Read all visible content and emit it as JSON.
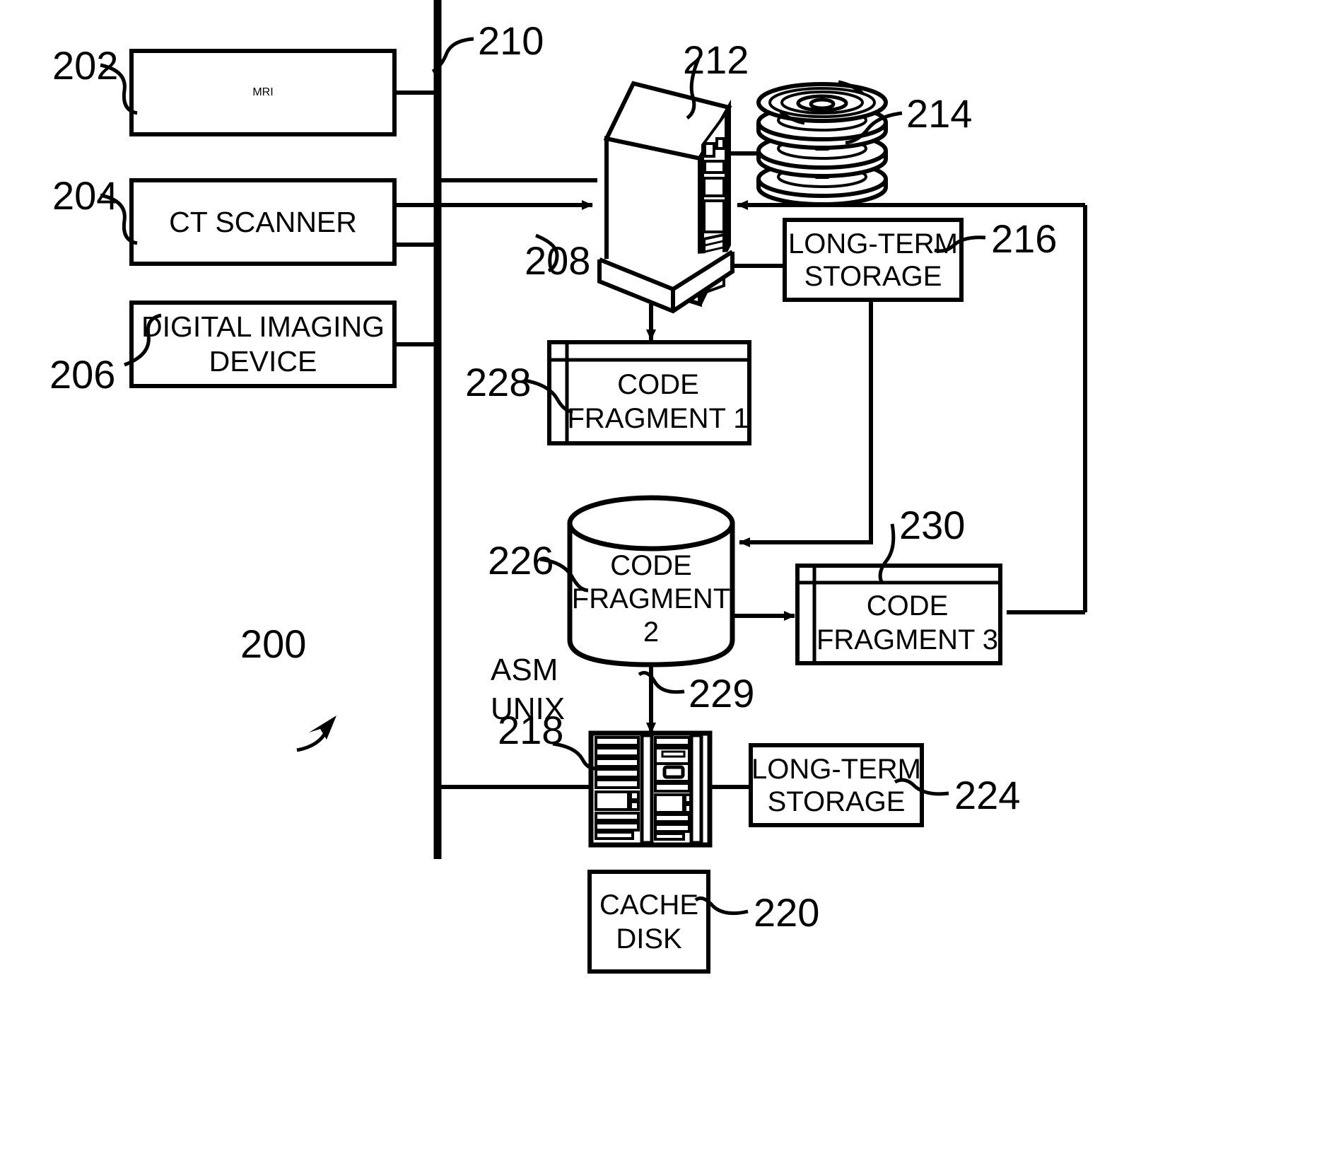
{
  "figure": {
    "kind": "patent-system-block-diagram",
    "system_ref": "200",
    "line_color": "#000000",
    "background": "#ffffff"
  },
  "nodes": {
    "mri": {
      "ref": "202",
      "label": "MRI"
    },
    "ct_scanner": {
      "ref": "204",
      "label": "CT SCANNER"
    },
    "digital_imaging_device": {
      "ref": "206",
      "label_line1": "DIGITAL IMAGING",
      "label_line2": "DEVICE"
    },
    "bus_link": {
      "ref": "208"
    },
    "network_bus": {
      "ref": "210"
    },
    "server": {
      "ref": "212"
    },
    "disk_stack": {
      "ref": "214"
    },
    "long_term_storage_top": {
      "ref": "216",
      "label_line1": "LONG-TERM",
      "label_line2": "STORAGE"
    },
    "storage_rack": {
      "ref": "218",
      "os_line1": "ASM",
      "os_line2": "UNIX"
    },
    "cache_disk": {
      "ref": "220",
      "label_line1": "CACHE",
      "label_line2": "DISK"
    },
    "long_term_storage_bottom": {
      "ref": "224",
      "label_line1": "LONG-TERM",
      "label_line2": "STORAGE"
    },
    "code_fragment_2": {
      "ref": "226",
      "label_line1": "CODE",
      "label_line2": "FRAGMENT",
      "label_line3": "2"
    },
    "code_fragment_1": {
      "ref": "228",
      "label_line1": "CODE",
      "label_line2": "FRAGMENT 1"
    },
    "flow_to_rack": {
      "ref": "229"
    },
    "code_fragment_3": {
      "ref": "230",
      "label_line1": "CODE",
      "label_line2": "FRAGMENT 3"
    }
  },
  "ref_numbers": {
    "n200": "200",
    "n202": "202",
    "n204": "204",
    "n206": "206",
    "n208": "208",
    "n210": "210",
    "n212": "212",
    "n214": "214",
    "n216": "216",
    "n218": "218",
    "n220": "220",
    "n224": "224",
    "n226": "226",
    "n228": "228",
    "n229": "229",
    "n230": "230"
  }
}
